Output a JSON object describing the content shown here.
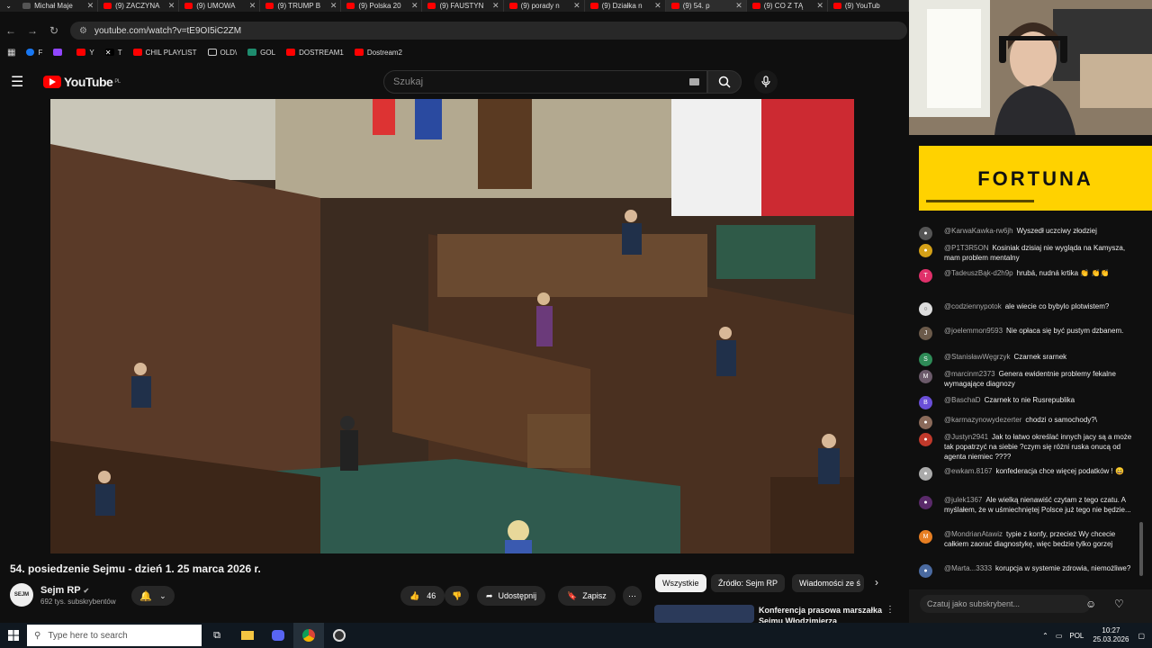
{
  "browser": {
    "tabs": [
      {
        "label": "Michał Maje"
      },
      {
        "label": "(9) ZACZYNA"
      },
      {
        "label": "(9) UMOWA"
      },
      {
        "label": "(9) TRUMP B"
      },
      {
        "label": "(9) Polska 20"
      },
      {
        "label": "(9) FAUSTYN"
      },
      {
        "label": "(9) porady n"
      },
      {
        "label": "(9) Działka n"
      },
      {
        "label": "(9) 54. p"
      },
      {
        "label": "(9) CO Z TĄ"
      },
      {
        "label": "(9) YouTub"
      }
    ],
    "url": "youtube.com/watch?v=tE9OI5iC2ZM",
    "bookmarks": [
      "F",
      "Y",
      "T",
      "CHIL PLAYLIST",
      "OLD\\",
      "GOL",
      "DOSTREAM1",
      "Dostream2"
    ]
  },
  "youtube": {
    "logo": "YouTube",
    "logo_region": "PL",
    "search_placeholder": "Szukaj",
    "video_title": "54. posiedzenie Sejmu - dzień 1. 25 marca 2026 r.",
    "channel_name": "Sejm RP",
    "channel_avatar_text": "SEJM",
    "subscribers": "692 tys. subskrybentów",
    "likes": "46",
    "share_label": "Udostępnij",
    "save_label": "Zapisz",
    "chips": [
      "Wszystkie",
      "Źródło: Sejm RP",
      "Wiadomości ze ś"
    ],
    "related_title": "Konferencja prasowa marszałka Sejmu Włodzimierza"
  },
  "stream": {
    "sponsor": "FORTUNA",
    "chat_placeholder": "Czatuj jako subskrybent...",
    "messages": [
      {
        "user": "@KarwaKawka-rw6jh",
        "text": "Wyszedł uczciwy złodziej",
        "color": "#555555"
      },
      {
        "user": "@P1T3R5ON",
        "text": "Kosiniak dzisiaj nie wygląda na Kamysza, mam problem mentalny",
        "color": "#d4a017"
      },
      {
        "user": "@TadeuszBąk-d2h9p",
        "text": "hrubá, nudná krtika 👏 👏👏",
        "color": "#e0306a"
      },
      {
        "user": "@codziennypotok",
        "text": "ale wiecie co bybylo plotwistem?",
        "color": "#dddddd"
      },
      {
        "user": "@joelemmon9593",
        "text": "Nie opłaca się być pustym dzbanem.",
        "color": "#6b5a4a"
      },
      {
        "user": "@StanisławWęgrzyk",
        "text": "Czarnek srarnek",
        "color": "#2e8b57"
      },
      {
        "user": "@marcinm2373",
        "text": "Genera ewidentnie problemy fekalne wymagające diagnozy",
        "color": "#6b5a6a"
      },
      {
        "user": "@BaschaD",
        "text": "Czarnek to nie Rusrepublika",
        "color": "#6a4fd8"
      },
      {
        "user": "@karmazynowydezerter",
        "text": "chodzi o samochody?\\",
        "color": "#8a6a5a"
      },
      {
        "user": "@Justyn2941",
        "text": "Jak to łatwo określać innych jacy są a może tak popatrzyć na siebie ?czym się różni ruska onucą od agenta niemiec ????",
        "color": "#c0392b"
      },
      {
        "user": "@ewkam.8167",
        "text": "konfederacja chce więcej podatków ! 😄",
        "color": "#aaaaaa"
      },
      {
        "user": "@julek1367",
        "text": "Ale wielką nienawiść czytam z tego czatu. A myślałem, że w uśmiechniętej Polsce już tego nie będzie...",
        "color": "#5a2a6a"
      },
      {
        "user": "@MondrianAtawiz",
        "text": "typie z konfy, przecież Wy chcecie całkiem zaorać diagnostykę, więc bedzie tylko gorzej",
        "color": "#e67e22"
      },
      {
        "user": "@Marta...3333",
        "text": "korupcja w systemie zdrowia, niemożliwe?",
        "color": "#4a6aa0"
      }
    ]
  },
  "taskbar": {
    "search_placeholder": "Type here to search",
    "lang": "POL",
    "time": "10:27",
    "date": "25.03.2026"
  }
}
